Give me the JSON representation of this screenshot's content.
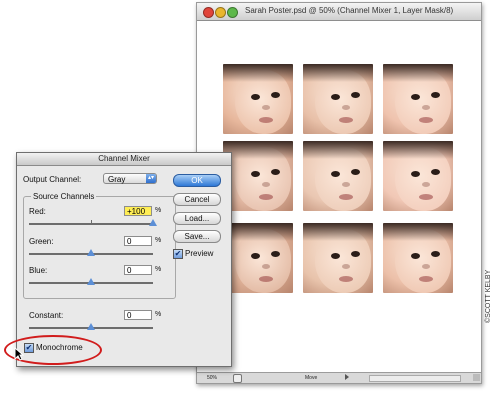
{
  "document": {
    "title": "Sarah Poster.psd @ 50% (Channel Mixer 1, Layer Mask/8)",
    "zoom": "50%",
    "status_label": "Move"
  },
  "dialog": {
    "title": "Channel Mixer",
    "output_channel_label": "Output Channel:",
    "output_channel_value": "Gray",
    "source_channels_label": "Source Channels",
    "channels": [
      {
        "label": "Red:",
        "value": "+100",
        "percent": "%",
        "slider_fraction": 1.0
      },
      {
        "label": "Green:",
        "value": "0",
        "percent": "%",
        "slider_fraction": 0.5
      },
      {
        "label": "Blue:",
        "value": "0",
        "percent": "%",
        "slider_fraction": 0.5
      }
    ],
    "constant": {
      "label": "Constant:",
      "value": "0",
      "percent": "%",
      "slider_fraction": 0.5
    },
    "monochrome_label": "Monochrome",
    "monochrome_checked": true,
    "buttons": {
      "ok": "OK",
      "cancel": "Cancel",
      "load": "Load...",
      "save": "Save..."
    },
    "preview_label": "Preview",
    "preview_checked": true
  },
  "credit": "©SCOTT KELBY",
  "colors": {
    "highlight_field": "#ffee55",
    "callout": "#d11c1c",
    "primary_button": "#2e78d6"
  }
}
